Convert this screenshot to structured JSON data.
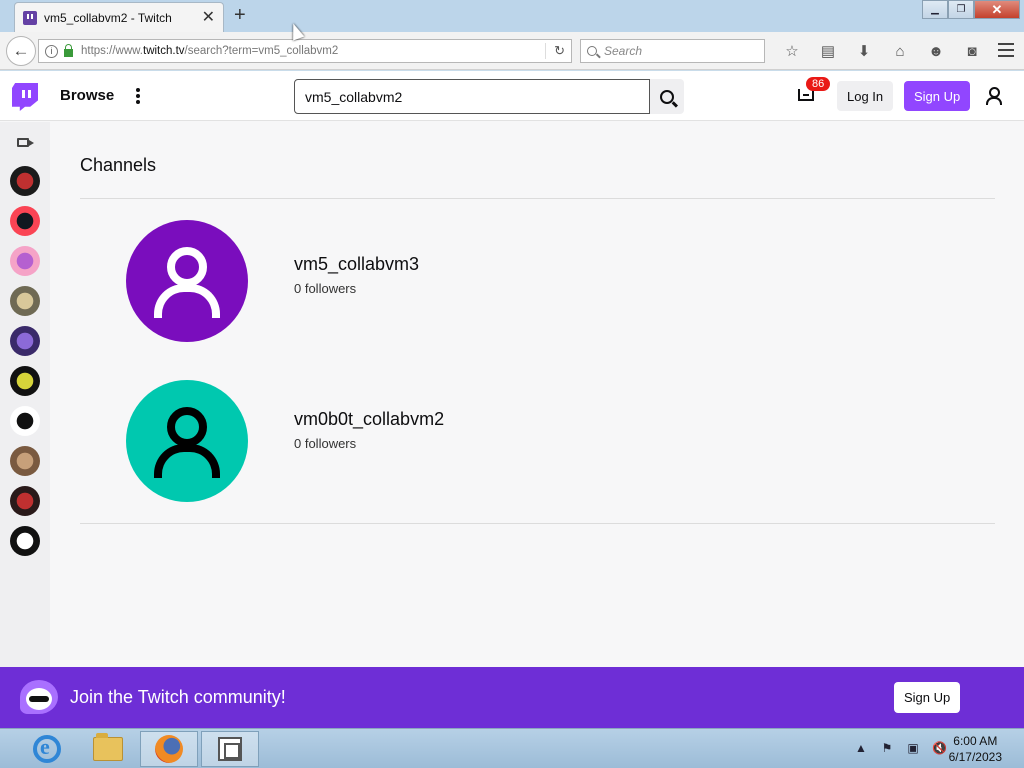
{
  "browser": {
    "tab_title": "vm5_collabvm2 - Twitch",
    "url_prefix": "https://www.",
    "url_domain": "twitch.tv",
    "url_path": "/search?term=vm5_collabvm2",
    "search_placeholder": "Search",
    "toolbar_icons": [
      "star-icon",
      "reading-list-icon",
      "download-icon",
      "home-icon",
      "smiley-icon",
      "pocket-icon",
      "hamburger-menu-icon"
    ]
  },
  "twitch": {
    "nav": {
      "browse_label": "Browse",
      "search_value": "vm5_collabvm2",
      "notification_count": "86",
      "login_label": "Log In",
      "signup_label": "Sign Up"
    },
    "sidebar": {
      "avatars": [
        {
          "name": "sidebar-channel-1",
          "color": "#1b1b1b",
          "accent": "#c03030"
        },
        {
          "name": "sidebar-channel-2",
          "color": "#fa4454",
          "accent": "#101820"
        },
        {
          "name": "sidebar-channel-3",
          "color": "#f5a3c7",
          "accent": "#b560d0"
        },
        {
          "name": "sidebar-channel-4",
          "color": "#6f6a54",
          "accent": "#d8c89a"
        },
        {
          "name": "sidebar-channel-5",
          "color": "#3a2a6a",
          "accent": "#8c6ad8"
        },
        {
          "name": "sidebar-channel-6",
          "color": "#111111",
          "accent": "#d6d43a"
        },
        {
          "name": "sidebar-channel-7",
          "color": "#ffffff",
          "accent": "#111111"
        },
        {
          "name": "sidebar-channel-8",
          "color": "#7a5a40",
          "accent": "#c7a07a"
        },
        {
          "name": "sidebar-channel-9",
          "color": "#2a1a1a",
          "accent": "#c03030"
        },
        {
          "name": "sidebar-channel-10",
          "color": "#111111",
          "accent": "#ffffff"
        }
      ]
    },
    "results": {
      "section_title": "Channels",
      "channels": [
        {
          "name": "vm5_collabvm3",
          "followers": "0 followers",
          "avatar_bg": "#7a0dbd",
          "avatar_fg": "#ffffff"
        },
        {
          "name": "vm0b0t_collabvm2",
          "followers": "0 followers",
          "avatar_bg": "#00c8af",
          "avatar_fg": "#000000"
        }
      ]
    },
    "banner": {
      "text": "Join the Twitch community!",
      "button_label": "Sign Up"
    }
  },
  "taskbar": {
    "time": "6:00 AM",
    "date": "6/17/2023"
  },
  "colors": {
    "twitch_purple": "#9146ff",
    "banner_purple": "#6e2ed6",
    "badge_red": "#e91916"
  }
}
